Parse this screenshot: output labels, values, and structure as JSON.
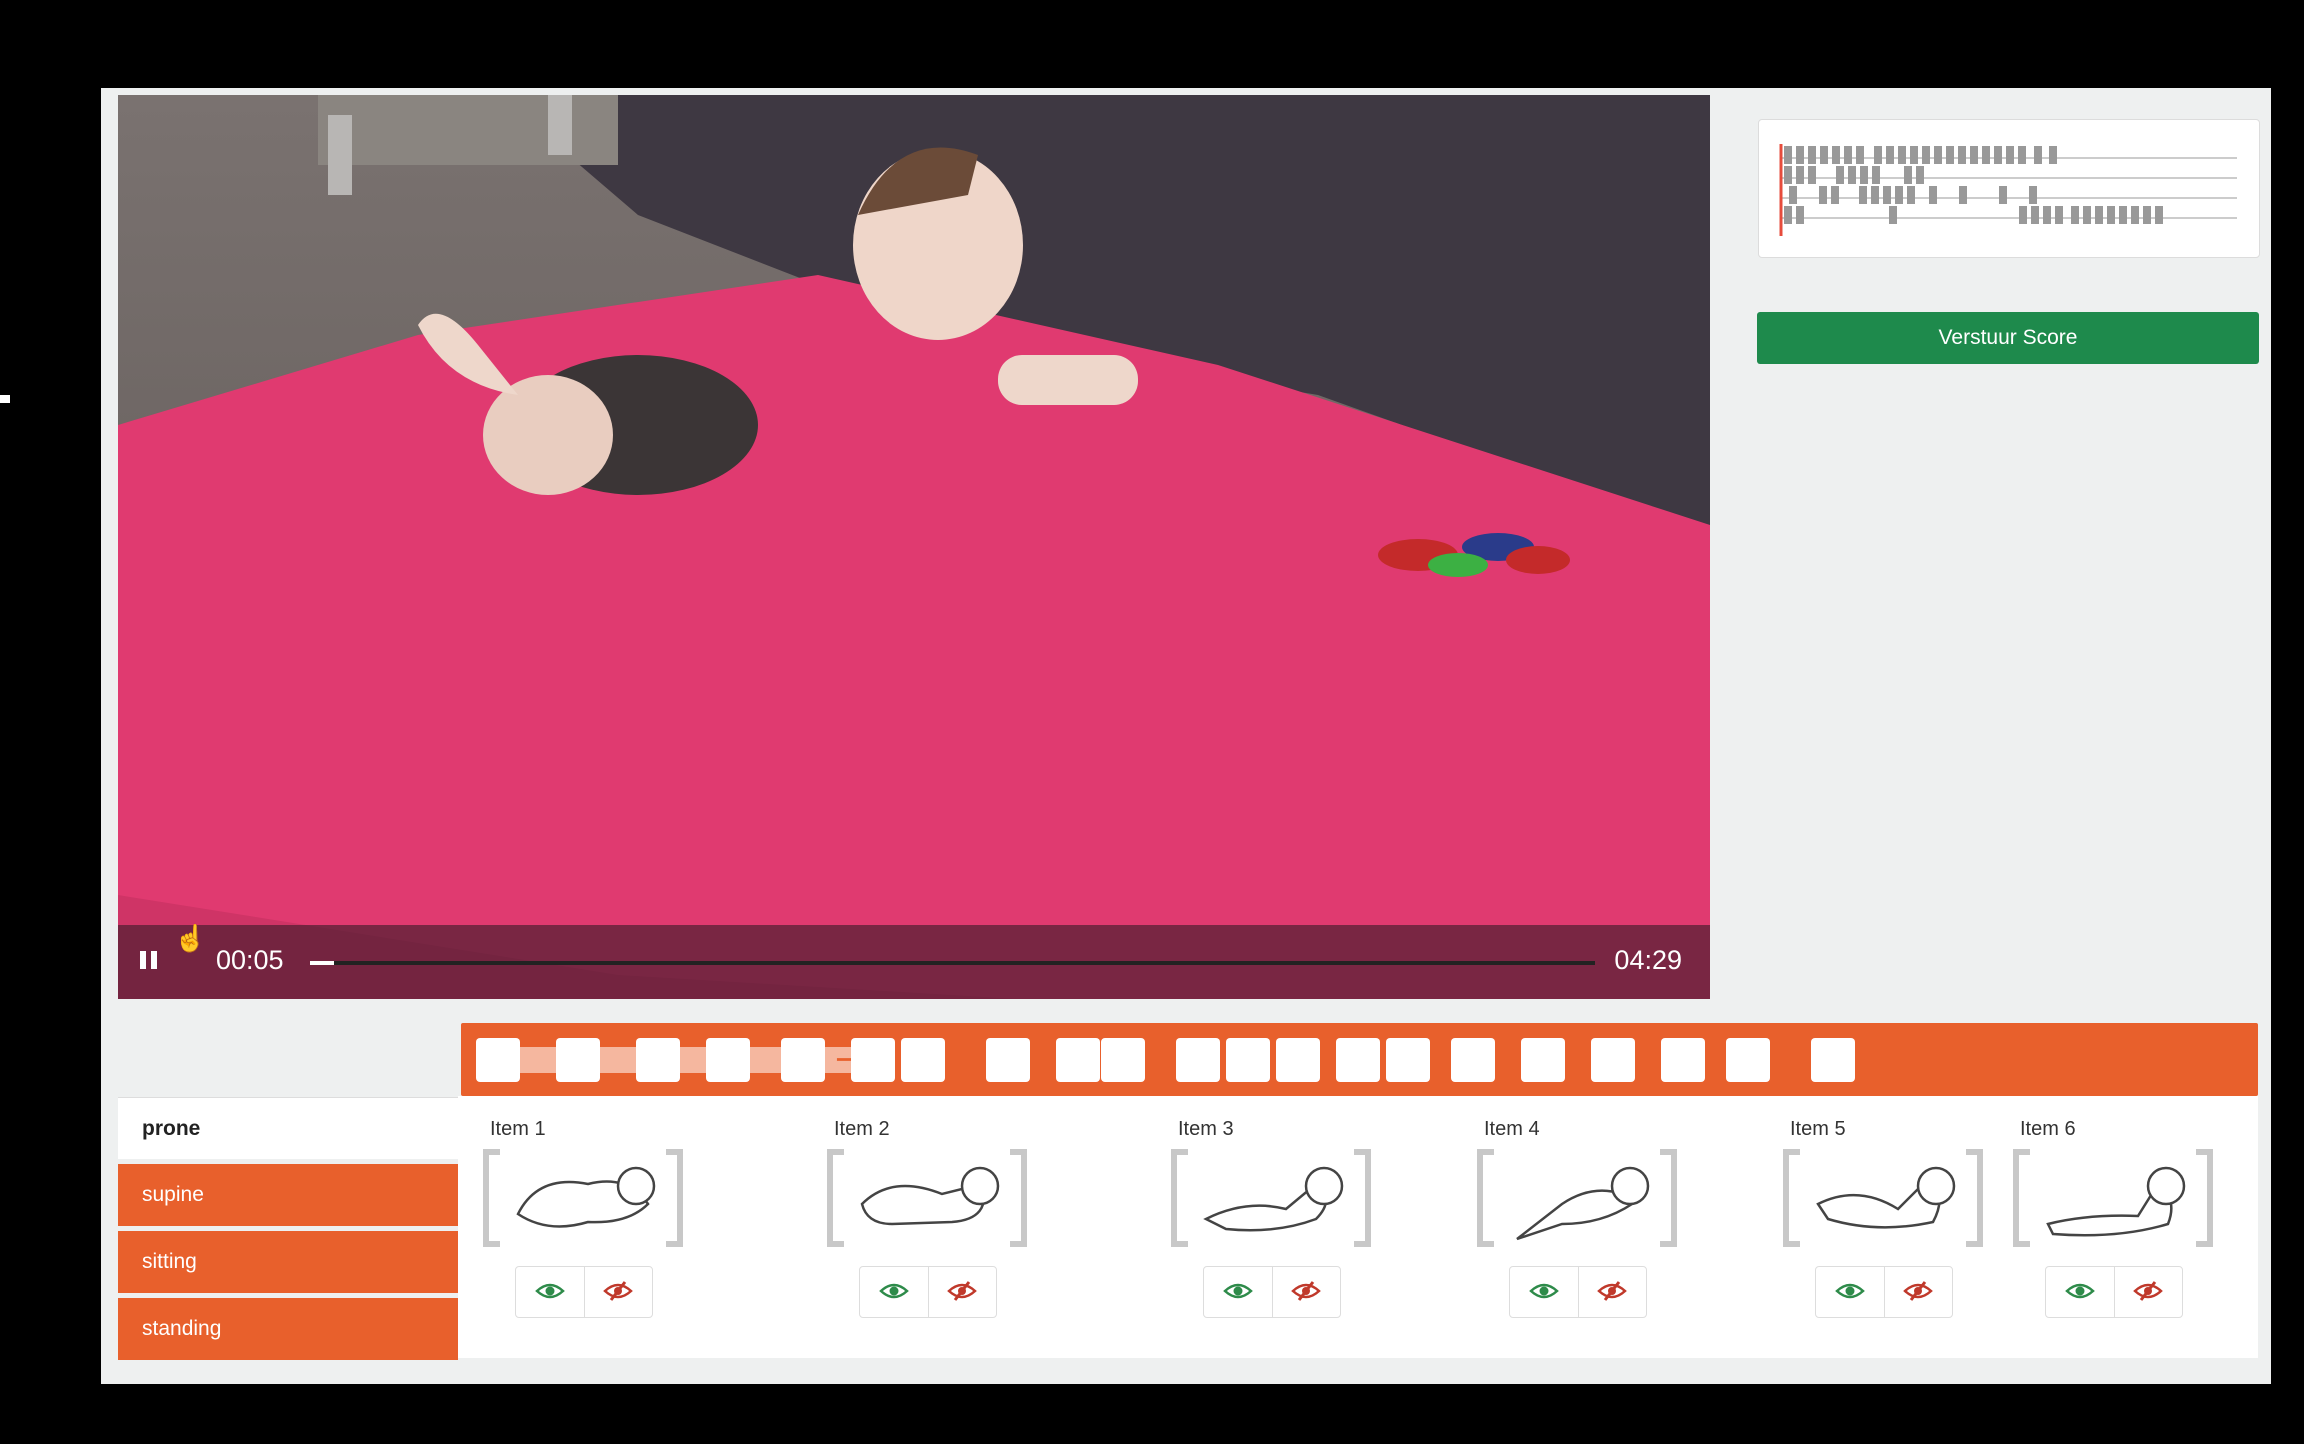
{
  "player": {
    "current_time": "00:05",
    "total_time": "04:29",
    "progress": 0.019,
    "state": "playing"
  },
  "sidebar": {
    "submit_label": "Verstuur Score"
  },
  "tabs": [
    {
      "label": "prone",
      "active": true
    },
    {
      "label": "supine",
      "active": false
    },
    {
      "label": "sitting",
      "active": false
    },
    {
      "label": "standing",
      "active": false
    }
  ],
  "items": [
    {
      "label": "Item 1"
    },
    {
      "label": "Item 2"
    },
    {
      "label": "Item 3"
    },
    {
      "label": "Item 4"
    },
    {
      "label": "Item 5"
    },
    {
      "label": "Item 6"
    }
  ],
  "icons": {
    "view": "eye-icon",
    "hide": "eye-slash-icon",
    "pause": "pause-icon"
  },
  "colors": {
    "accent": "#e8602c",
    "submit": "#1e8a4c",
    "view_icon": "#2e8b4a",
    "hide_icon": "#c0392b"
  }
}
